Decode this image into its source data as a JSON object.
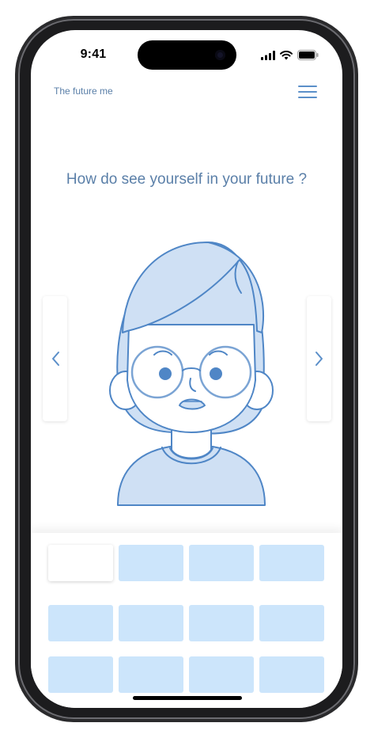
{
  "status_bar": {
    "time": "9:41",
    "icons": [
      "signal-icon",
      "wifi-icon",
      "battery-icon"
    ]
  },
  "header": {
    "app_title": "The future me",
    "menu_icon": "hamburger-menu-icon"
  },
  "main": {
    "question": "How do see yourself in your future ?",
    "avatar": "girl-with-glasses-avatar",
    "prev_icon": "chevron-left-icon",
    "next_icon": "chevron-right-icon"
  },
  "tiles": {
    "rows": 3,
    "columns": 4,
    "selected_index": 0
  },
  "colors": {
    "accent": "#5b8fc9",
    "title_text": "#5a7fa8",
    "tile_fill": "#cce5fb",
    "avatar_fill": "#cfe0f4",
    "avatar_stroke": "#4f86c6"
  }
}
